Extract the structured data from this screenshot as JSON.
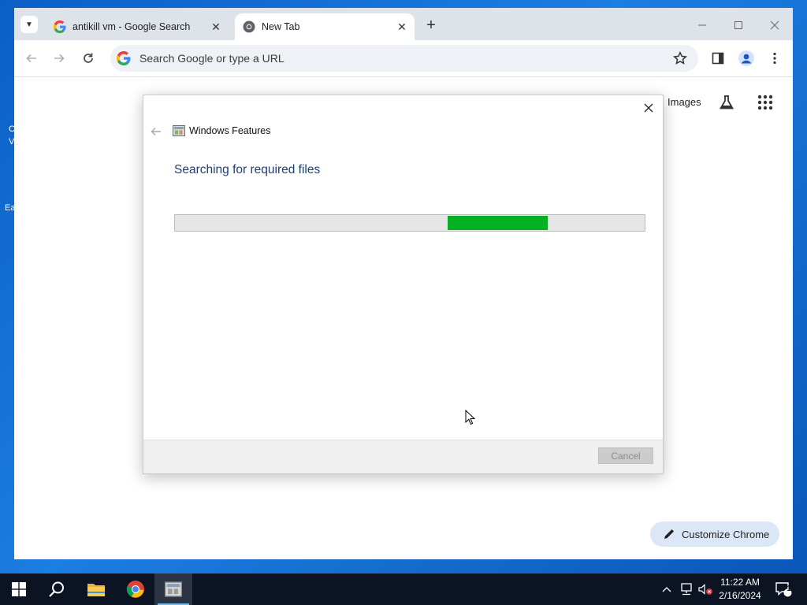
{
  "browser": {
    "tabs": [
      {
        "title": "antikill vm - Google Search",
        "icon": "google-g-icon",
        "active": false
      },
      {
        "title": "New Tab",
        "icon": "chrome-icon",
        "active": true
      }
    ],
    "omnibox": {
      "placeholder": "Search Google or type a URL"
    },
    "ntp": {
      "images_link": "Images",
      "customize_button": "Customize Chrome"
    }
  },
  "dialog": {
    "title": "Windows Features",
    "heading": "Searching for required files",
    "progress": {
      "state": "indeterminate",
      "color": "#06B025"
    },
    "cancel_label": "Cancel"
  },
  "taskbar": {
    "apps": [
      "start-icon",
      "search-icon",
      "file-explorer-icon",
      "chrome-icon",
      "windows-features-icon"
    ],
    "time": "11:22 AM",
    "date": "2/16/2024",
    "notification_count": "1"
  },
  "desktop": {
    "icon_fragments": [
      "C",
      "V",
      "Ea"
    ]
  },
  "colors": {
    "accent": "#1A73E8",
    "progress": "#06B025",
    "taskbar": "#0C1322"
  }
}
